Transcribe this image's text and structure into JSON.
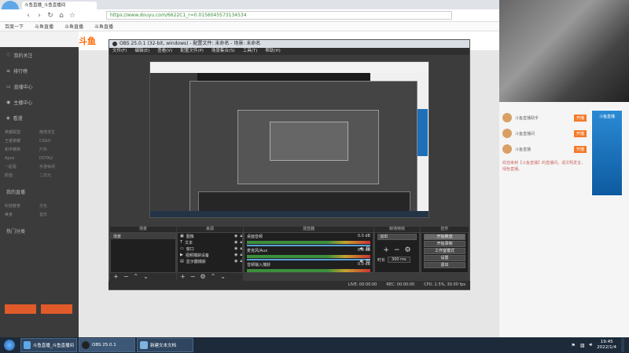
{
  "browser": {
    "url": "https://www.douyu.com/6622C1_r=0.0156045573134534",
    "bookmarks": [
      "百度一下",
      "斗鱼直播",
      "斗鱼直播",
      "斗鱼直播"
    ]
  },
  "site": {
    "logo_text": "斗鱼",
    "sidebar_items": [
      "我的关注",
      "排行榜",
      "直播中心",
      "主播中心",
      "看漫"
    ],
    "sidebar_grid": [
      "英雄联盟",
      "绝地求生",
      "王者荣耀",
      "CSGO",
      "和平精英",
      "户外",
      "Apex",
      "DOTA2",
      "一起看",
      "手游休闲",
      "颜值",
      "二次元",
      "科技教育",
      "文化",
      "美食",
      "音乐"
    ],
    "sidebar_sections": [
      "我的直播",
      "热门分类"
    ]
  },
  "chat": {
    "rows": [
      {
        "name": "斗鱼直播助手",
        "badge": "开播"
      },
      {
        "name": "斗鱼直播间",
        "badge": "开播"
      },
      {
        "name": "斗鱼直播",
        "badge": "开播"
      }
    ],
    "notice": "欢迎来到【斗鱼直播】的直播间，请文明发言，绿色直播。",
    "banner": "斗鱼直播"
  },
  "obs": {
    "title": "OBS 25.0.1 (32-bit, windows) - 配置文件: 未命名 - 场景: 未命名",
    "menu": [
      "文件(F)",
      "编辑(E)",
      "查看(V)",
      "配置文件(P)",
      "场景集合(S)",
      "工具(T)",
      "帮助(H)"
    ],
    "panels": {
      "scenes": "场景",
      "sources": "来源",
      "mixer": "混音器",
      "transitions": "转场特效",
      "controls": "控件"
    },
    "scene_items": [
      "场景"
    ],
    "source_items": [
      "图像",
      "文本",
      "窗口",
      "视频捕获设备",
      "显示器捕获"
    ],
    "mixer_tracks": [
      {
        "name": "桌面音频",
        "db": "0.0 dB"
      },
      {
        "name": "麦克风/Aux",
        "db": "0.0 dB"
      },
      {
        "name": "音频输入捕获",
        "db": "0.0 dB"
      }
    ],
    "transition": {
      "type": "淡出",
      "duration_label": "时长",
      "duration": "300 ms"
    },
    "controls": [
      "开始推流",
      "开始录制",
      "工作室模式",
      "设置",
      "退出"
    ],
    "status": {
      "live": "LIVE: 00:00:00",
      "rec": "REC: 00:00:00",
      "cpu": "CPU: 2.5%, 30.00 fps"
    }
  },
  "taskbar": {
    "tasks": [
      "斗鱼直播_斗鱼直播间",
      "OBS 25.0.1",
      "新建文本文档"
    ],
    "time": "19:45",
    "date": "2022/1/4"
  }
}
